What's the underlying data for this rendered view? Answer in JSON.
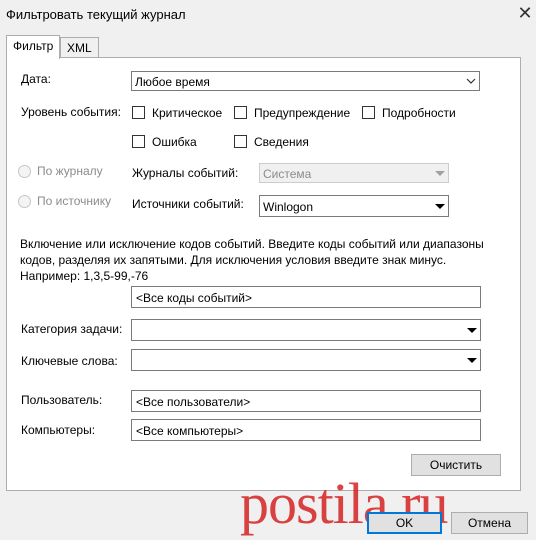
{
  "window": {
    "title": "Фильтровать текущий журнал",
    "close": "✕"
  },
  "tabs": [
    {
      "label": "Фильтр"
    },
    {
      "label": "XML"
    }
  ],
  "date": {
    "label": "Дата:",
    "value": "Любое время"
  },
  "level": {
    "label": "Уровень события:",
    "options": [
      {
        "label": "Критическое",
        "checked": false
      },
      {
        "label": "Предупреждение",
        "checked": false
      },
      {
        "label": "Подробности",
        "checked": false
      },
      {
        "label": "Ошибка",
        "checked": false
      },
      {
        "label": "Сведения",
        "checked": false
      }
    ]
  },
  "source": {
    "by_log": {
      "label": "По журналу"
    },
    "by_source": {
      "label": "По источнику"
    },
    "logs_label": "Журналы событий:",
    "logs_value": "Система",
    "sources_label": "Источники событий:",
    "sources_value": "Winlogon"
  },
  "help_text": "Включение или исключение кодов событий. Введите коды событий или диапазоны кодов, разделяя их запятыми. Для исключения условия введите знак минус. Например: 1,3,5-99,-76",
  "event_ids": {
    "value": "<Все коды событий>"
  },
  "task_category": {
    "label": "Категория задачи:",
    "value": ""
  },
  "keywords": {
    "label": "Ключевые слова:",
    "value": ""
  },
  "user": {
    "label": "Пользователь:",
    "value": "<Все пользователи>"
  },
  "computer": {
    "label": "Компьютеры:",
    "value": "<Все компьютеры>"
  },
  "buttons": {
    "clear": "Очистить",
    "ok": "OK",
    "cancel": "Отмена"
  },
  "watermark": "postila.ru"
}
